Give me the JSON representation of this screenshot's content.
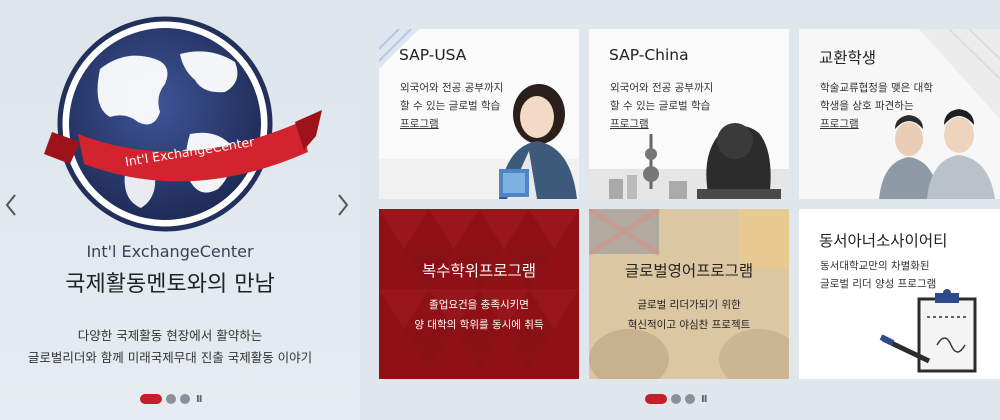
{
  "slider": {
    "globe_ribbon": "Int'l ExchangeCenter",
    "subtitle": "Int'l ExchangeCenter",
    "title": "국제활동멘토와의 만남",
    "desc_line1": "다양한 국제활동 현장에서 활약하는",
    "desc_line2": "글로벌리더와 함께 미래국제무대 진출 국제활동 이야기",
    "prev_icon": "chevron-left-icon",
    "next_icon": "chevron-right-icon",
    "pause_label": "II"
  },
  "tiles": {
    "sap_usa": {
      "title": "SAP-USA",
      "line1": "외국어와 전공 공부까지",
      "line2": "할 수 있는 글로벌 학습",
      "line3": "프로그램"
    },
    "sap_china": {
      "title": "SAP-China",
      "line1": "외국어와 전공 공부까지",
      "line2": "할 수 있는 글로벌 학습",
      "line3": "프로그램"
    },
    "exchange": {
      "title": "교환학생",
      "line1": "학술교류협정을 맺은 대학",
      "line2": "학생을 상호 파견하는",
      "line3": "프로그램"
    },
    "dual_degree": {
      "title": "복수학위프로그램",
      "line1": "졸업요건을 충족시키면",
      "line2": "양 대학의 학위를 동시에 취득"
    },
    "global_english": {
      "title": "글로벌영어프로그램",
      "line1": "글로벌 리더가되기 위한",
      "line2": "혁신적이고 야심찬 프로젝트"
    },
    "ambassador": {
      "title": "동서아너소사이어티",
      "line1": "동서대학교만의 차별화된",
      "line2": "글로벌 리더 양성 프로그램"
    }
  },
  "tile_pager": {
    "pause_label": "II"
  },
  "colors": {
    "accent_red": "#c41f2b",
    "dual_bg": "#8f1116",
    "globe_blue": "#2b3a6b"
  }
}
